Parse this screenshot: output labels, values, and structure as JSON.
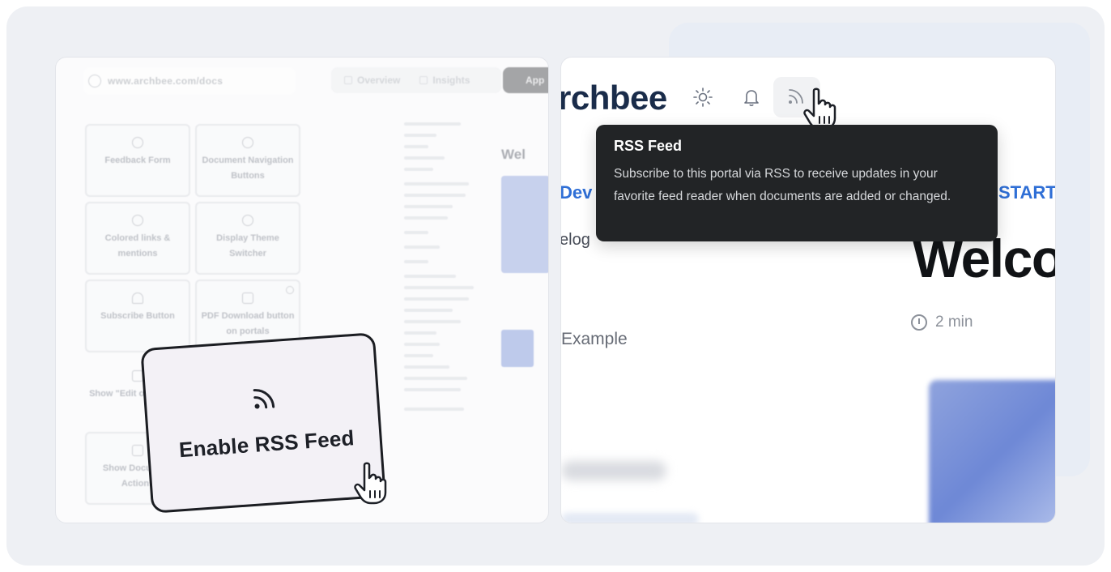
{
  "left_panel": {
    "url": "www.archbee.com/docs",
    "tabs": [
      {
        "label": "Overview"
      },
      {
        "label": "Insights"
      }
    ],
    "app_button_label": "App",
    "cards": [
      {
        "label": "Feedback Form",
        "icon": "thumbs-icon"
      },
      {
        "label": "Document Navigation Buttons",
        "icon": "arrows-icon"
      },
      {
        "label": "Colored links & mentions",
        "icon": "palette-icon"
      },
      {
        "label": "Display Theme Switcher",
        "icon": "sun-icon"
      },
      {
        "label": "Subscribe Button",
        "icon": "bell-icon"
      },
      {
        "label": "PDF Download button on portals",
        "icon": "download-icon"
      },
      {
        "label": "Show \"Edit on GitHub\"",
        "icon": "github-icon"
      },
      {
        "label": "Show Document Actions",
        "icon": "document-icon"
      }
    ],
    "doc_preview_heading": "Wel"
  },
  "enable_card": {
    "label": "Enable RSS Feed",
    "icon": "rss-icon"
  },
  "right_panel": {
    "brand": "rchbee",
    "header_icons": [
      "sun-icon",
      "bell-icon",
      "rss-icon"
    ],
    "nav_left": "Dev",
    "nav_right": "START",
    "sidebar_item_1": "elog",
    "sidebar_item_2": "Example",
    "heading": "Welco",
    "read_time": "2 min"
  },
  "tooltip": {
    "title": "RSS Feed",
    "body": "Subscribe to this portal via RSS to receive updates in your favorite feed reader when documents are added or changed."
  },
  "colors": {
    "tooltip_bg": "#222426",
    "brand_text": "#1a2c4a",
    "link_blue": "#2f6fd6",
    "card_border": "#1b1d22"
  }
}
